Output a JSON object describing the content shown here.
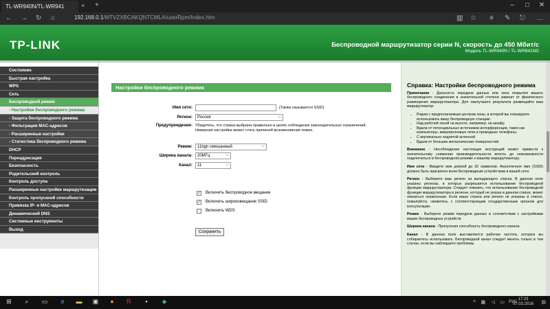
{
  "browser": {
    "tab_title": "TL-WR940N/TL-WR941",
    "tab_close": "×",
    "tab_add": "+",
    "url_host": "192.168.0.1",
    "url_path": "/MTVZXBCAKQNTCMLA/userRpm/Index.htm"
  },
  "router": {
    "logo": "TP-LINK",
    "title": "Беспроводной маршрутизатор серии N, скорость до 450 Мбит/с",
    "model": "Модель TL-WR940N / TL-WR941ND"
  },
  "sidebar": {
    "items": [
      {
        "label": "Состояние",
        "type": "main"
      },
      {
        "label": "Быстрая настройка",
        "type": "main"
      },
      {
        "label": "WPS",
        "type": "main"
      },
      {
        "label": "Сеть",
        "type": "main"
      },
      {
        "label": "Беспроводной режим",
        "type": "active"
      },
      {
        "label": "- Настройки беспроводного режима",
        "type": "activesub"
      },
      {
        "label": "- Защита беспроводного режима",
        "type": "sub"
      },
      {
        "label": "- Фильтрация MAC-адресов",
        "type": "sub"
      },
      {
        "label": "- Расширенные настройки",
        "type": "sub"
      },
      {
        "label": "- Статистика беспроводного режима",
        "type": "sub"
      },
      {
        "label": "DHCP",
        "type": "main"
      },
      {
        "label": "Переадресация",
        "type": "main"
      },
      {
        "label": "Безопасность",
        "type": "main"
      },
      {
        "label": "Родительский контроль",
        "type": "main"
      },
      {
        "label": "Контроль доступа",
        "type": "main"
      },
      {
        "label": "Расширенные настройки маршрутизации",
        "type": "main"
      },
      {
        "label": "Контроль пропускной способности",
        "type": "main"
      },
      {
        "label": "Привязка IP- и MAC-адресов",
        "type": "main"
      },
      {
        "label": "Динамический DNS",
        "type": "main"
      },
      {
        "label": "Системные инструменты",
        "type": "main"
      },
      {
        "label": "Выход",
        "type": "main"
      }
    ]
  },
  "form": {
    "header": "Настройки беспроводного режима",
    "ssid_label": "Имя сети:",
    "ssid_value": "",
    "ssid_note": "(Также называется SSID)",
    "region_label": "Регион:",
    "region_value": "Россия",
    "warning_label": "Предупреждение:",
    "warning_text_1": "Убедитесь, что страна выбрана правильно в целях соблюдения законодательных ограничений.",
    "warning_text_2": "Неверная настройка может стать причиной возникновения помех.",
    "mode_label": "Режим:",
    "mode_value": "11bgn смешанный",
    "width_label": "Ширина канала:",
    "width_value": "20МГц",
    "channel_label": "Канал:",
    "channel_value": "11",
    "chk_radio": "Включить беспроводное вещание",
    "chk_ssid": "Включить широковещание SSID",
    "chk_wds": "Включить WDS",
    "save": "Сохранить"
  },
  "help": {
    "title": "Справка: Настройки беспроводного режима",
    "note_label": "Примечание",
    "note_text": " - Дальность передачи данных или зона покрытия вашего беспроводного соединения в значительной степени зависит от физического размещения маршрутизатора. Для наилучшего результата размещайте ваш маршрутизатор:",
    "bullets": [
      "Рядом с предполагаемым центром зоны, в которой вы планируете использовать вашу беспроводную станцию.",
      "Над рабочей зоной на высоте, например, на шкафу.",
      "Вдали от потенциальных источников интерференции, таких как компьютеры, микроволновые печи и проводные телефоны.",
      "С вертикально поднятой антенной",
      "Вдали от больших металлических поверхностей"
    ],
    "warn_label": "Внимание",
    "warn_text": " - Несоблюдение настоящих инструкций может привести к значительному снижению производительности вплоть до невозможности подключиться в беспроводном режиме к вашему маршрутизатору.",
    "ssid_label": "Имя сети",
    "ssid_text": " - Введите имя длиной до 32 символов. Аналогичное имя (SSID) должно быть присвоено всем беспроводным устройствам в вашей сети.",
    "region_label": "Регион",
    "region_text": " - Выберите ваш регион из выпадающего списка. В данном поле указаны регионы, в которых разрешается использование беспроводной функции маршрутизатора. Следует помнить, что использование беспроводной функции маршрутизатора в регионе, который не указан в данном списке, может оказаться незаконным. Если ваша страна или регион не указаны в списке, пожалуйста, свяжитесь с соответствующим государственным органом для консультации.",
    "mode_label": "Режим",
    "mode_text": " - Выберите режим передачи данных в соответствии с настройками ваших беспроводных устройств.",
    "width_label": "Ширина канала",
    "width_text": " - Пропускная способность беспроводного канала",
    "channel_label": "Канал",
    "channel_text": " - В данном поле выставляется рабочая частота, которую вы собираетесь использовать. Беспроводной канал следует менять только в том случае, если вы наблюдаете проблемы"
  },
  "taskbar": {
    "lang": "РУС",
    "time": "17:23",
    "date": "07.03.2016"
  }
}
